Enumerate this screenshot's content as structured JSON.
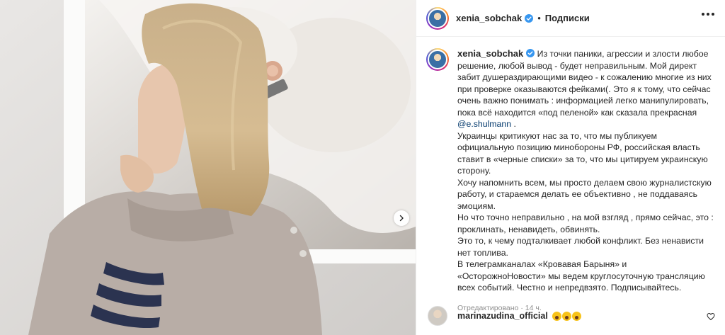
{
  "post": {
    "username": "xenia_sobchak",
    "verified": true,
    "separator": "•",
    "follow_label": "Подписки",
    "caption_part1": "Из точки паники, агрессии и злости любое решение, любой вывод - будет неправильным. Мой директ забит душераздирающими видео - к сожалению многие из них при проверке оказываются фейками(. Это я к тому, что сейчас очень важно понимать : информацией легко манипулировать, пока всё находится «под пеленой» как сказала прекрасная",
    "mention": "@e.shulmann",
    "caption_part1_end": " .",
    "caption_part2": "Украинцы критикуют нас за то, что мы публикуем официальную позицию минобороны РФ, российская власть ставит в «черные списки» за то, что мы цитируем украинскую сторону.\nХочу напомнить всем, мы просто делаем свою журналистскую работу, и стараемся делать ее объективно , не поддаваясь эмоциям.\nНо что точно неправильно , на мой взгляд , прямо сейчас, это : проклинать, ненавидеть, обвинять.\nЭто то, к чему подталкивает любой конфликт. Без ненависти нет топлива.\nВ телеграмканалах «Кровавая Барыня» и «ОсторожноНовости» мы ведем круглосуточную трансляцию всех событий. Честно и непредвзято. Подписывайтесь.",
    "edited_label": "Отредактировано",
    "meta_separator": "·",
    "time_ago": "14 ч."
  },
  "comment": {
    "username": "marinazudina_official",
    "emoji_names": [
      "scream-emoji",
      "scream-emoji",
      "scream-emoji"
    ]
  },
  "icons": {
    "verified": "verified-badge-icon",
    "more": "more-options-icon",
    "next": "chevron-right-icon",
    "like": "heart-icon"
  },
  "colors": {
    "verified": "#3897f0",
    "mention": "#00376b",
    "muted": "#8e8e8e",
    "text": "#262626"
  }
}
